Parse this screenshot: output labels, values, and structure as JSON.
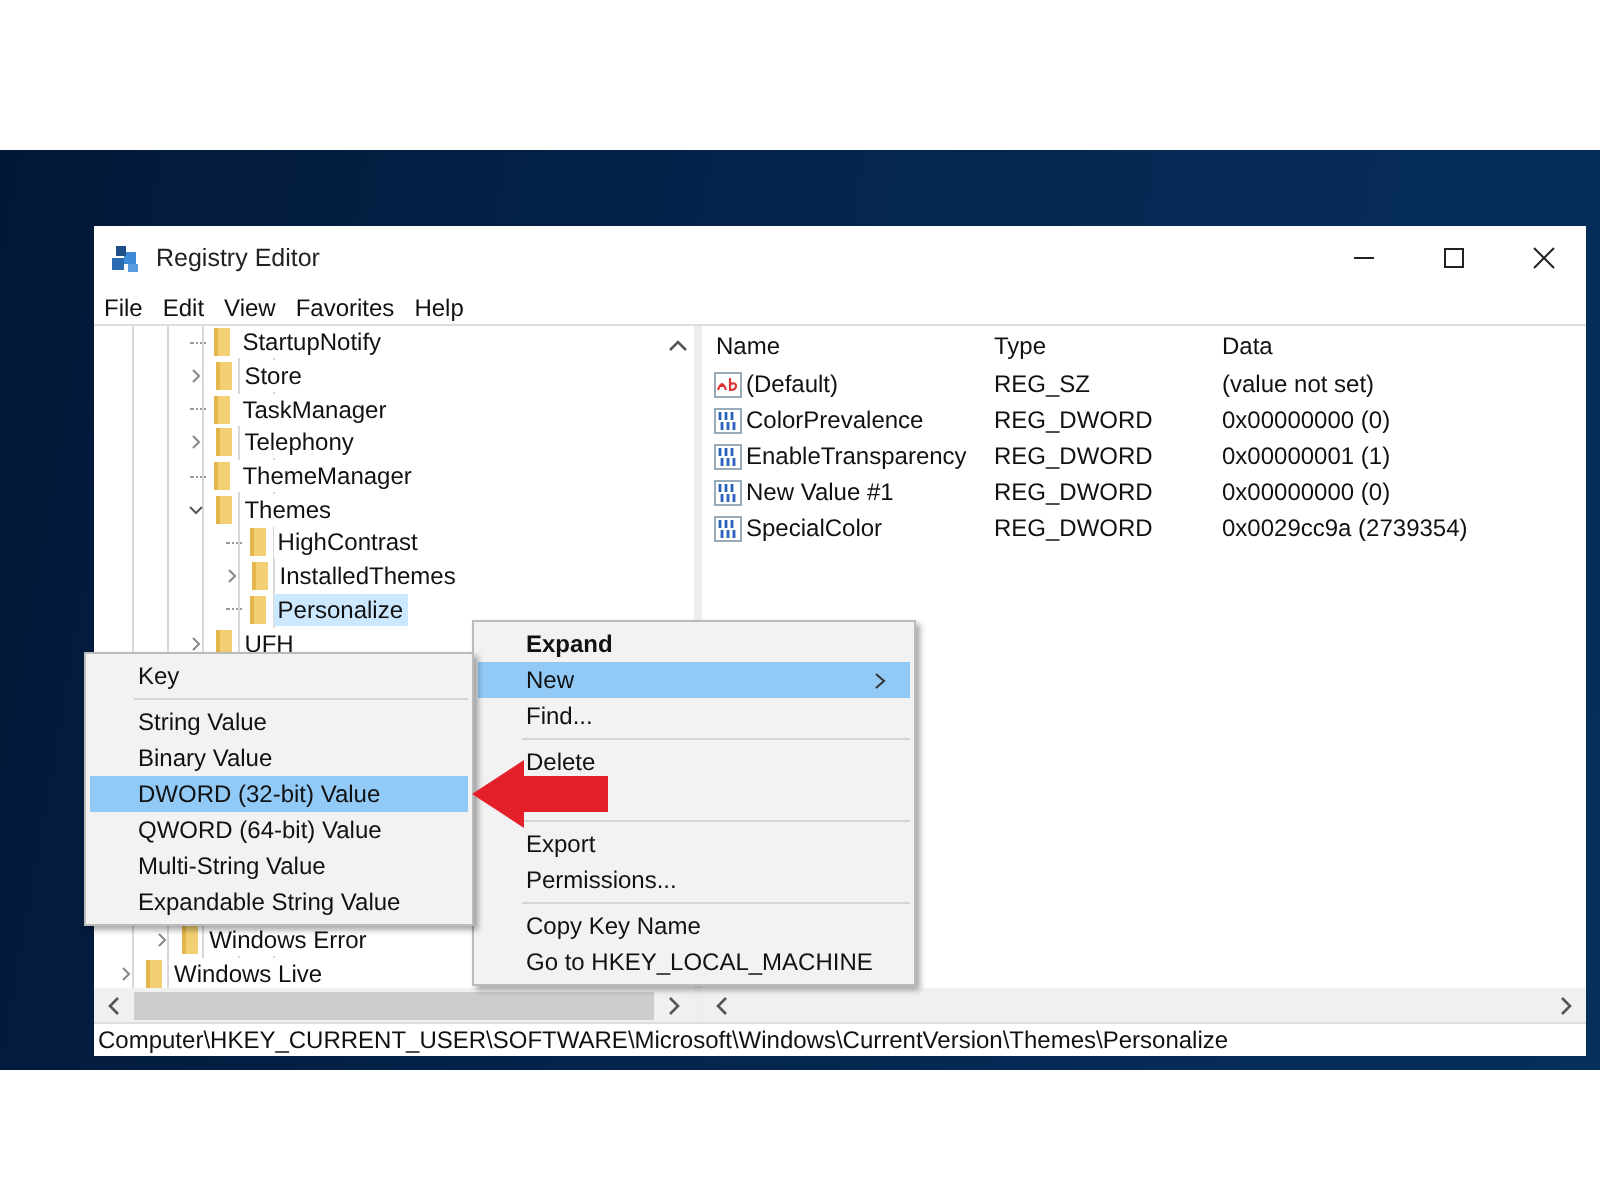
{
  "window": {
    "title": "Registry Editor"
  },
  "menu_bar": [
    "File",
    "Edit",
    "View",
    "Favorites",
    "Help"
  ],
  "tree": [
    {
      "children": [
        {
          "children": [
            {
              "label": "StartupNotify",
              "selected": false
            },
            {
              "label": "Store",
              "selected": false,
              "expanded": false
            },
            {
              "label": "TaskManager",
              "selected": false
            },
            {
              "label": "Telephony",
              "selected": false,
              "expanded": false
            },
            {
              "label": "ThemeManager",
              "selected": false
            },
            {
              "label": "Themes",
              "selected": false,
              "expanded": true,
              "children": [
                {
                  "label": "HighContrast",
                  "selected": false
                },
                {
                  "label": "InstalledThemes",
                  "selected": false,
                  "expanded": false
                },
                {
                  "label": "Personalize",
                  "selected": true
                }
              ]
            },
            {
              "label": "UFH",
              "selected": false,
              "expanded": false
            }
          ]
        },
        {
          "label": "Windows Error",
          "selected": false,
          "expanded": false
        }
      ]
    },
    {
      "label": "Windows Live",
      "selected": false,
      "expanded": false
    }
  ],
  "values_table": {
    "columns": [
      "Name",
      "Type",
      "Data"
    ],
    "rows": [
      {
        "kind": "string",
        "name": "(Default)",
        "type": "REG_SZ",
        "data": "(value not set)"
      },
      {
        "kind": "dword",
        "name": "ColorPrevalence",
        "type": "REG_DWORD",
        "data": "0x00000000 (0)"
      },
      {
        "kind": "dword",
        "name": "EnableTransparency",
        "type": "REG_DWORD",
        "data": "0x00000001 (1)"
      },
      {
        "kind": "dword",
        "name": "New Value #1",
        "type": "REG_DWORD",
        "data": "0x00000000 (0)"
      },
      {
        "kind": "dword",
        "name": "SpecialColor",
        "type": "REG_DWORD",
        "data": "0x0029cc9a (2739354)"
      }
    ]
  },
  "context_menu": [
    {
      "kind": "item",
      "label": "Expand",
      "default": true,
      "selected": false
    },
    {
      "kind": "item",
      "label": "New",
      "default": false,
      "selected": true,
      "submenu": true
    },
    {
      "kind": "item",
      "label": "Find...",
      "default": false,
      "selected": false
    },
    {
      "kind": "separator"
    },
    {
      "kind": "item",
      "label": "Delete",
      "default": false,
      "selected": false
    },
    {
      "kind": "separator"
    },
    {
      "kind": "item",
      "label": "Export",
      "default": false,
      "selected": false
    },
    {
      "kind": "item",
      "label": "Permissions...",
      "default": false,
      "selected": false
    },
    {
      "kind": "separator"
    },
    {
      "kind": "item",
      "label": "Copy Key Name",
      "default": false,
      "selected": false
    },
    {
      "kind": "item",
      "label": "Go to HKEY_LOCAL_MACHINE",
      "default": false,
      "selected": false
    }
  ],
  "new_submenu": [
    {
      "kind": "item",
      "label": "Key",
      "selected": false
    },
    {
      "kind": "separator"
    },
    {
      "kind": "item",
      "label": "String Value",
      "selected": false
    },
    {
      "kind": "item",
      "label": "Binary Value",
      "selected": false
    },
    {
      "kind": "item",
      "label": "DWORD (32-bit) Value",
      "selected": true
    },
    {
      "kind": "item",
      "label": "QWORD (64-bit) Value",
      "selected": false
    },
    {
      "kind": "item",
      "label": "Multi-String Value",
      "selected": false
    },
    {
      "kind": "item",
      "label": "Expandable String Value",
      "selected": false
    }
  ],
  "status_bar": "Computer\\HKEY_CURRENT_USER\\SOFTWARE\\Microsoft\\Windows\\CurrentVersion\\Themes\\Personalize"
}
